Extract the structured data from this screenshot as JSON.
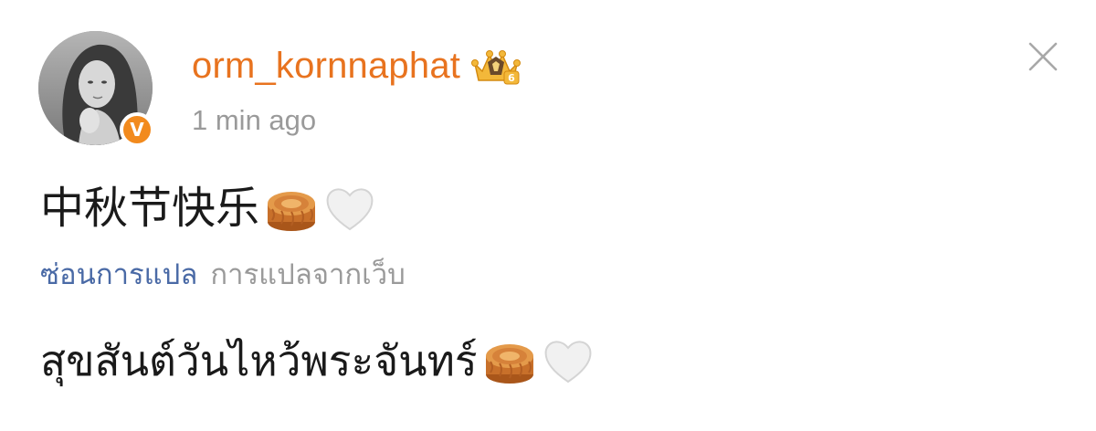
{
  "post": {
    "author": {
      "username": "orm_kornnaphat",
      "verified_badge": "V",
      "avatar": "profile-photo",
      "level_badge": "crown-level-6-icon"
    },
    "timestamp": "1 min ago",
    "original_text": "中秋节快乐",
    "original_emojis": [
      "mooncake-icon",
      "white-heart-icon"
    ],
    "translation": {
      "hide_label": "ซ่อนการแปล",
      "source_label": "การแปลจากเว็บ"
    },
    "translated_text": "สุขสันต์วันไหว้พระจันทร์",
    "translated_emojis": [
      "mooncake-icon",
      "white-heart-icon"
    ]
  },
  "actions": {
    "close_icon": "close-icon"
  },
  "colors": {
    "username": "#e8731f",
    "verified_badge": "#f28a1d",
    "link": "#4a6aa6",
    "muted_text": "#9a9a9a",
    "body_text": "#1a1a1a"
  }
}
